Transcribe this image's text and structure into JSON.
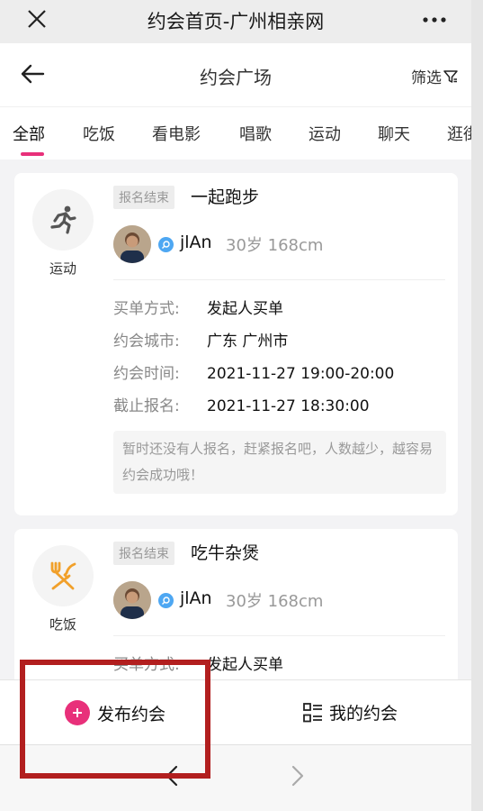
{
  "topbar": {
    "title": "约会首页-广州相亲网",
    "close_icon": "close-icon",
    "more_icon": "more-icon"
  },
  "navbar": {
    "title": "约会广场",
    "filter_label": "筛选",
    "back_icon": "back-arrow-icon",
    "filter_icon": "funnel-icon"
  },
  "tabs": [
    "全部",
    "吃饭",
    "看电影",
    "唱歌",
    "运动",
    "聊天",
    "逛街"
  ],
  "accent_color": "#e8307a",
  "cards": [
    {
      "category": "运动",
      "category_icon": "running-icon",
      "status": "报名结束",
      "title": "一起跑步",
      "user": {
        "name": "jlAn",
        "info": "30岁 168cm"
      },
      "rows": [
        {
          "label": "买单方式:",
          "value": "发起人买单"
        },
        {
          "label": "约会城市:",
          "value": "广东 广州市"
        },
        {
          "label": "约会时间:",
          "value": "2021-11-27 19:00-20:00"
        },
        {
          "label": "截止报名:",
          "value": "2021-11-27 18:30:00"
        }
      ],
      "notice": "暂时还没有人报名，赶紧报名吧，人数越少，越容易约会成功哦！"
    },
    {
      "category": "吃饭",
      "category_icon": "fork-knife-icon",
      "status": "报名结束",
      "title": "吃牛杂煲",
      "user": {
        "name": "jlAn",
        "info": "30岁 168cm"
      },
      "rows": [
        {
          "label": "买单方式:",
          "value": "发起人买单"
        }
      ]
    }
  ],
  "bottom": {
    "publish_label": "发布约会",
    "mine_label": "我的约会"
  }
}
